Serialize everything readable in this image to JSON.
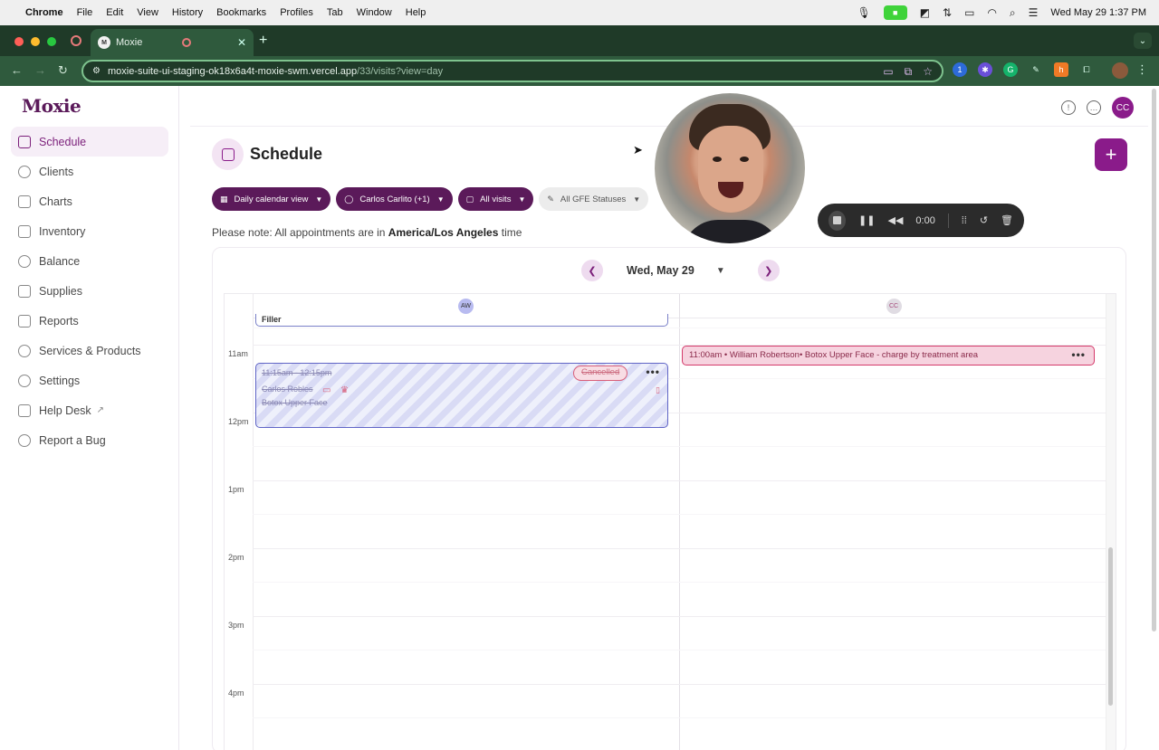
{
  "menubar": {
    "app": "Chrome",
    "items": [
      "File",
      "Edit",
      "View",
      "History",
      "Bookmarks",
      "Profiles",
      "Tab",
      "Window",
      "Help"
    ],
    "datetime": "Wed May 29  1:37 PM"
  },
  "browser": {
    "tab_title": "Moxie",
    "tab_favicon": "M",
    "url_host": "moxie-suite-ui-staging-ok18x6a4t-moxie-swm.vercel.app",
    "url_path": "/33/visits?view=day"
  },
  "app": {
    "logo": "Moxie",
    "user_initials": "CC",
    "sidebar": {
      "items": [
        {
          "label": "Schedule",
          "icon": "calendar-icon",
          "active": true
        },
        {
          "label": "Clients",
          "icon": "users-icon"
        },
        {
          "label": "Charts",
          "icon": "chart-icon"
        },
        {
          "label": "Inventory",
          "icon": "box-icon"
        },
        {
          "label": "Balance",
          "icon": "dollar-icon"
        },
        {
          "label": "Supplies",
          "icon": "cart-icon"
        },
        {
          "label": "Reports",
          "icon": "report-icon"
        },
        {
          "label": "Services & Products",
          "icon": "tag-icon"
        },
        {
          "label": "Settings",
          "icon": "gear-icon"
        },
        {
          "label": "Help Desk",
          "icon": "help-icon",
          "external": true
        },
        {
          "label": "Report a Bug",
          "icon": "bug-icon"
        }
      ]
    },
    "page_title": "Schedule",
    "filters": {
      "view": "Daily calendar view",
      "provider": "Carlos Carlito (+1)",
      "visits": "All visits",
      "gfe": "All GFE Statuses"
    },
    "note": {
      "prefix": "Please note: All appointments are in ",
      "timezone": "America/Los Angeles",
      "suffix": " time"
    },
    "calendar": {
      "date": "Wed, May 29",
      "columns": [
        {
          "initials": "AW",
          "color": "#b8bbf0"
        },
        {
          "initials": "CC",
          "color": "#e0dce3"
        }
      ],
      "time_labels": [
        "11am",
        "12pm",
        "1pm",
        "2pm",
        "3pm",
        "4pm"
      ],
      "appointments": {
        "filler": {
          "label": "Filler"
        },
        "cancelled": {
          "time": "11:15am - 12:15pm",
          "client": "Carlos Robles",
          "service": "Botox Upper Face",
          "status": "Cancelled"
        },
        "cc": {
          "text": "11:00am • William Robertson• Botox Upper Face - charge by treatment area"
        }
      }
    }
  },
  "recorder": {
    "timer": "0:00"
  },
  "colors": {
    "brand": "#8a1b8a",
    "brand_dark": "#5b1a5a",
    "cancel_accent": "#d9607a",
    "event_pink": "#f6d3df"
  }
}
